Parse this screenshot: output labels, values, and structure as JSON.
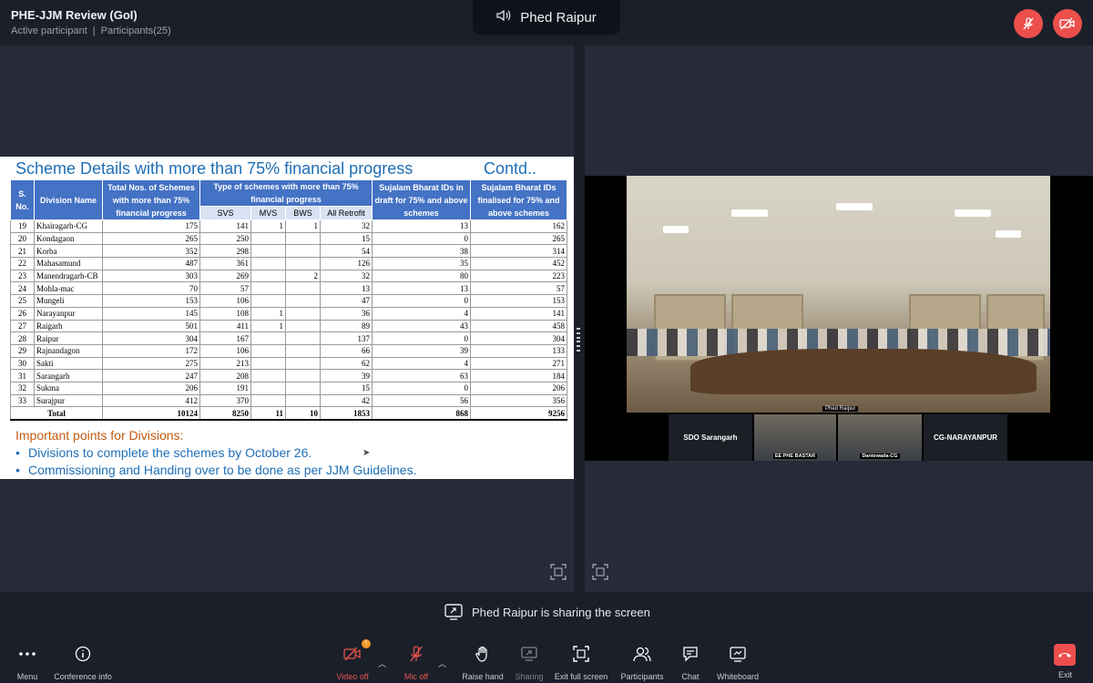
{
  "meeting": {
    "title": "PHE-JJM Review (GoI)",
    "status": "Active participant",
    "participants": "Participants(25)",
    "active_speaker": "Phed Raipur"
  },
  "slide": {
    "title": "Scheme Details with more than 75% financial progress",
    "contd": "Contd..",
    "headers": {
      "sno": "S. No.",
      "division": "Division Name",
      "total": "Total Nos. of Schemes with more than 75% financial progress",
      "type": "Type of schemes with more than 75% financial progress",
      "draft": "Sujalam Bharat IDs in draft for 75% and above schemes",
      "finalised": "Sujalam Bharat IDs finalised for 75% and above schemes",
      "svs": "SVS",
      "mvs": "MVS",
      "bws": "BWS",
      "retrofit": "All Retrofit"
    },
    "rows": [
      {
        "sno": "19",
        "name": "Khairagarh-CG",
        "total": "175",
        "svs": "141",
        "mvs": "1",
        "bws": "1",
        "retro": "32",
        "draft": "13",
        "final": "162"
      },
      {
        "sno": "20",
        "name": "Kondagaon",
        "total": "265",
        "svs": "250",
        "mvs": "",
        "bws": "",
        "retro": "15",
        "draft": "0",
        "final": "265"
      },
      {
        "sno": "21",
        "name": "Korba",
        "total": "352",
        "svs": "298",
        "mvs": "",
        "bws": "",
        "retro": "54",
        "draft": "38",
        "final": "314"
      },
      {
        "sno": "22",
        "name": "Mahasamund",
        "total": "487",
        "svs": "361",
        "mvs": "",
        "bws": "",
        "retro": "126",
        "draft": "35",
        "final": "452"
      },
      {
        "sno": "23",
        "name": "Manendragarh-CB",
        "total": "303",
        "svs": "269",
        "mvs": "",
        "bws": "2",
        "retro": "32",
        "draft": "80",
        "final": "223"
      },
      {
        "sno": "24",
        "name": "Mohla-mac",
        "total": "70",
        "svs": "57",
        "mvs": "",
        "bws": "",
        "retro": "13",
        "draft": "13",
        "final": "57"
      },
      {
        "sno": "25",
        "name": "Mungeli",
        "total": "153",
        "svs": "106",
        "mvs": "",
        "bws": "",
        "retro": "47",
        "draft": "0",
        "final": "153"
      },
      {
        "sno": "26",
        "name": "Narayanpur",
        "total": "145",
        "svs": "108",
        "mvs": "1",
        "bws": "",
        "retro": "36",
        "draft": "4",
        "final": "141"
      },
      {
        "sno": "27",
        "name": "Raigarh",
        "total": "501",
        "svs": "411",
        "mvs": "1",
        "bws": "",
        "retro": "89",
        "draft": "43",
        "final": "458"
      },
      {
        "sno": "28",
        "name": "Raipur",
        "total": "304",
        "svs": "167",
        "mvs": "",
        "bws": "",
        "retro": "137",
        "draft": "0",
        "final": "304"
      },
      {
        "sno": "29",
        "name": "Rajnandagon",
        "total": "172",
        "svs": "106",
        "mvs": "",
        "bws": "",
        "retro": "66",
        "draft": "39",
        "final": "133"
      },
      {
        "sno": "30",
        "name": "Sakti",
        "total": "275",
        "svs": "213",
        "mvs": "",
        "bws": "",
        "retro": "62",
        "draft": "4",
        "final": "271"
      },
      {
        "sno": "31",
        "name": "Sarangarh",
        "total": "247",
        "svs": "208",
        "mvs": "",
        "bws": "",
        "retro": "39",
        "draft": "63",
        "final": "184"
      },
      {
        "sno": "32",
        "name": "Sukma",
        "total": "206",
        "svs": "191",
        "mvs": "",
        "bws": "",
        "retro": "15",
        "draft": "0",
        "final": "206"
      },
      {
        "sno": "33",
        "name": "Surajpur",
        "total": "412",
        "svs": "370",
        "mvs": "",
        "bws": "",
        "retro": "42",
        "draft": "56",
        "final": "356"
      }
    ],
    "total_row": {
      "label": "Total",
      "total": "10124",
      "svs": "8250",
      "mvs": "11",
      "bws": "10",
      "retro": "1853",
      "draft": "868",
      "final": "9256"
    },
    "important_title": "Important points for Divisions:",
    "bullets": [
      "Divisions to complete the schemes by October 26.",
      "Commissioning and Handing over to be done as per JJM Guidelines."
    ]
  },
  "video": {
    "room_label": "Phed Raipur",
    "tiles": [
      "SDO Sarangarh",
      "EE PHE BASTAR",
      "Dantewada-CG",
      "CG-NARAYANPUR"
    ]
  },
  "share_banner": "Phed Raipur is sharing the screen",
  "toolbar": {
    "menu": "Menu",
    "conference_info": "Conference info",
    "video_off": "Video off",
    "video_badge": "!",
    "mic_off": "Mic off",
    "raise_hand": "Raise hand",
    "sharing": "Sharing",
    "exit_full_screen": "Exit full screen",
    "participants": "Participants",
    "chat": "Chat",
    "whiteboard": "Whiteboard",
    "exit": "Exit"
  },
  "colors": {
    "accent_red": "#ec4f4c",
    "slide_blue": "#1f6fb6",
    "header_blue": "#4472c4",
    "important_orange": "#c55a11"
  }
}
